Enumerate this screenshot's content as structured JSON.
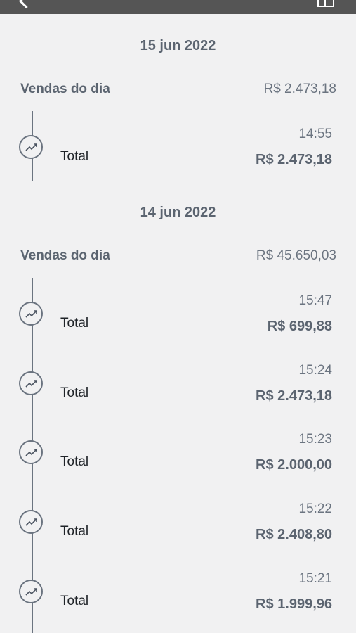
{
  "days": [
    {
      "date": "15 jun 2022",
      "label": "Vendas do dia",
      "total": "R$ 2.473,18",
      "transactions": [
        {
          "label": "Total",
          "time": "14:55",
          "amount": "R$ 2.473,18"
        }
      ]
    },
    {
      "date": "14 jun 2022",
      "label": "Vendas do dia",
      "total": "R$ 45.650,03",
      "transactions": [
        {
          "label": "Total",
          "time": "15:47",
          "amount": "R$ 699,88"
        },
        {
          "label": "Total",
          "time": "15:24",
          "amount": "R$ 2.473,18"
        },
        {
          "label": "Total",
          "time": "15:23",
          "amount": "R$ 2.000,00"
        },
        {
          "label": "Total",
          "time": "15:22",
          "amount": "R$ 2.408,80"
        },
        {
          "label": "Total",
          "time": "15:21",
          "amount": "R$ 1.999,96"
        }
      ]
    }
  ],
  "icons": {
    "back": "chevron-left-icon",
    "menu": "grid-icon",
    "transaction": "trending-up-icon"
  }
}
